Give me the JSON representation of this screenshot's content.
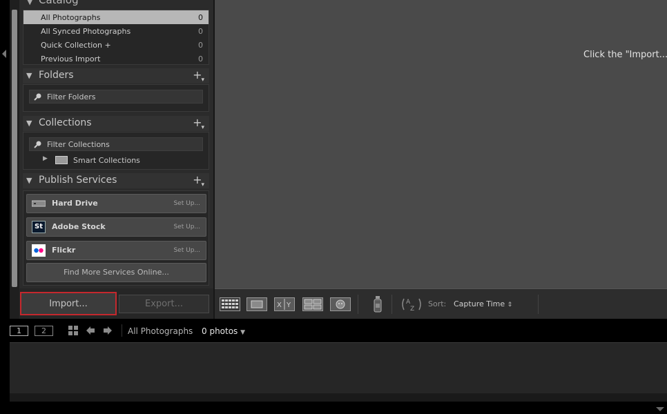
{
  "catalog": {
    "header": "Catalog",
    "items": [
      {
        "label": "All Photographs",
        "count": "0",
        "selected": true
      },
      {
        "label": "All Synced Photographs",
        "count": "0"
      },
      {
        "label": "Quick Collection +",
        "count": "0"
      },
      {
        "label": "Previous Import",
        "count": "0"
      }
    ]
  },
  "folders": {
    "header": "Folders",
    "filter_label": "Filter Folders"
  },
  "collections": {
    "header": "Collections",
    "filter_label": "Filter Collections",
    "smart_label": "Smart Collections"
  },
  "publish": {
    "header": "Publish Services",
    "services": [
      {
        "name": "Hard Drive",
        "setup": "Set Up...",
        "icon": "hard-drive-icon"
      },
      {
        "name": "Adobe Stock",
        "setup": "Set Up...",
        "icon": "adobe-stock-icon",
        "icon_text": "St"
      },
      {
        "name": "Flickr",
        "setup": "Set Up...",
        "icon": "flickr-icon"
      }
    ],
    "find_more": "Find More Services Online..."
  },
  "buttons": {
    "import": "Import...",
    "export": "Export..."
  },
  "main": {
    "hint": "Click the \"Import...\" b"
  },
  "toolbar": {
    "sort_label": "Sort:",
    "sort_value": "Capture Time"
  },
  "filmstrip": {
    "screen1": "1",
    "screen2": "2",
    "source": "All Photographs",
    "count": "0 photos"
  },
  "colors": {
    "accent_red": "#c5282d",
    "panel": "#2b2b2b",
    "main": "#4a4a4a"
  }
}
